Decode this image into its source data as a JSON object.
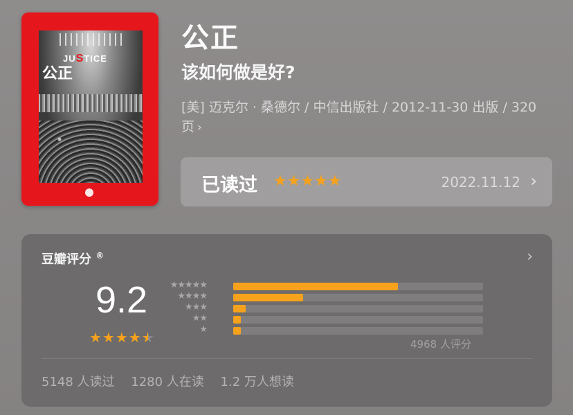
{
  "cover": {
    "title_en_prefix": "JU",
    "title_en_s": "S",
    "title_en_suffix": "TICE",
    "title_cn": "公正"
  },
  "book": {
    "title": "公正",
    "subtitle": "该如何做是好?",
    "meta": "[美] 迈克尔 · 桑德尔 / 中信出版社 / 2012-11-30 出版 / 320 页"
  },
  "read_status": {
    "label": "已读过",
    "stars": "★★★★★",
    "date": "2022.11.12"
  },
  "rating": {
    "header": "豆瓣评分",
    "header_mark": "®",
    "score": "9.2",
    "score_stars": 4.5,
    "count_text": "4968 人评分",
    "distribution": [
      {
        "stars": "★★★★★",
        "fraction": 0.66
      },
      {
        "stars": "★★★★",
        "fraction": 0.28
      },
      {
        "stars": "★★★",
        "fraction": 0.05
      },
      {
        "stars": "★★",
        "fraction": 0.03
      },
      {
        "stars": "★",
        "fraction": 0.03
      }
    ],
    "stats": [
      "5148 人读过",
      "1280 人在读",
      "1.2 万人想读"
    ]
  },
  "colors": {
    "accent_star": "#f6a21c",
    "cover_red": "#e5171c"
  }
}
